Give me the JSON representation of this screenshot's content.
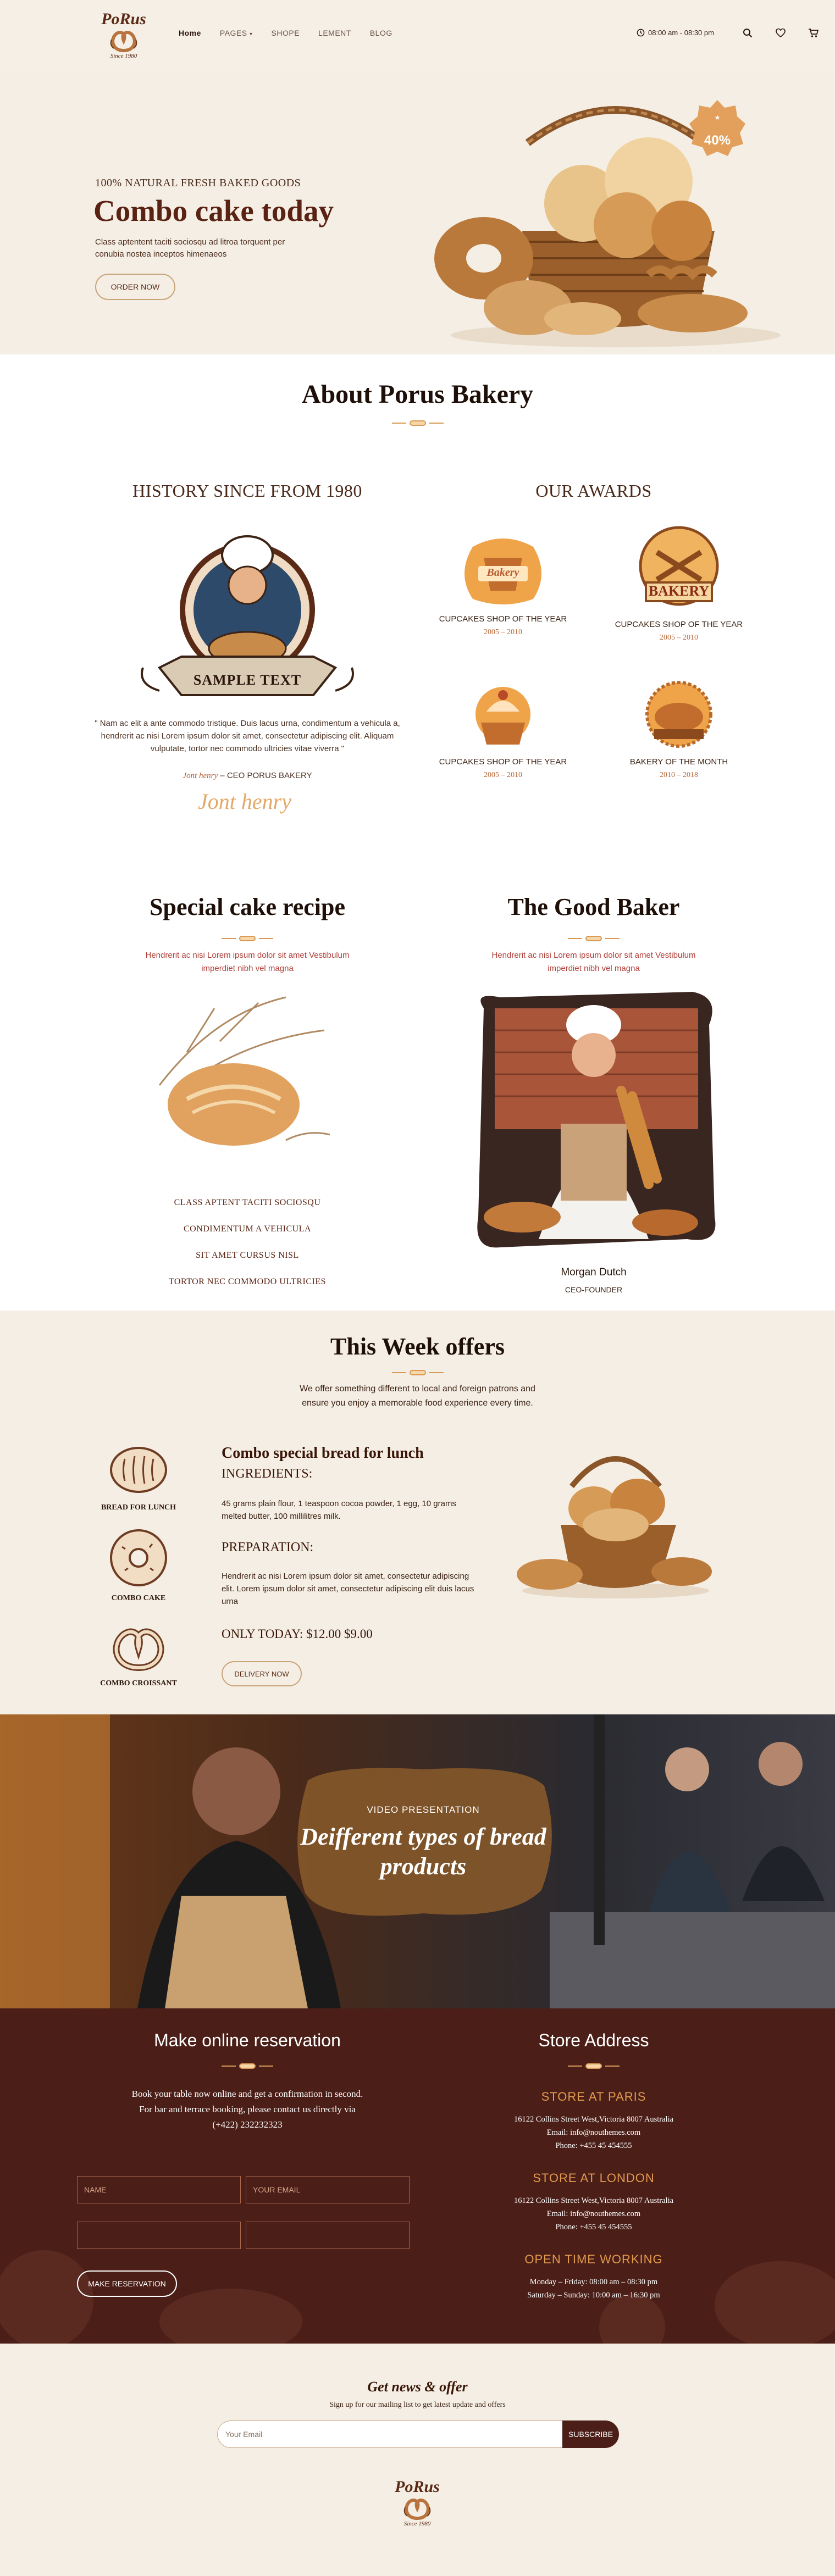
{
  "header": {
    "logo": {
      "brand": "PoRus",
      "since": "Since 1980"
    },
    "nav": [
      "Home",
      "PAGES",
      "SHOPE",
      "LEMENT",
      "BLOG"
    ],
    "hours": "08:00 am - 08:30 pm",
    "icons": [
      "search-icon",
      "heart-icon",
      "cart-icon"
    ]
  },
  "hero": {
    "eyebrow": "100% NATURAL FRESH BAKED GOODS",
    "title": "Combo cake today",
    "text": "Class aptentent taciti sociosqu ad litroa torquent per conubia nostea inceptos himenaeos",
    "button": "ORDER NOW",
    "badge": "40%"
  },
  "about": {
    "title": "About Porus Bakery",
    "history_title": "HISTORY SINCE FROM 1980",
    "emblem_text": "SAMPLE TEXT",
    "quote": "\" Nam ac elit a ante commodo tristique. Duis lacus urna, condimentum a vehicula a, hendrerit ac nisi Lorem ipsum dolor sit amet, consectetur adipiscing elit. Aliquam vulputate, tortor nec commodo ultricies vitae viverra \"",
    "author": "Jont henry",
    "author_role": " – CEO PORUS BAKERY",
    "signature": "Jont henry",
    "awards_title": "OUR AWARDS",
    "awards": [
      {
        "name": "CUPCAKES SHOP OF THE YEAR",
        "years": "2005 – 2010",
        "badge": "Bakery"
      },
      {
        "name": "CUPCAKES SHOP OF THE YEAR",
        "years": "2005 – 2010",
        "badge": "BAKERY"
      },
      {
        "name": "CUPCAKES SHOP OF THE YEAR",
        "years": "2005 – 2010",
        "badge": ""
      },
      {
        "name": "BAKERY OF THE MONTH",
        "years": "2010 – 2018",
        "badge": ""
      }
    ]
  },
  "recipe": {
    "title": "Special cake recipe",
    "text": "Hendrerit ac nisi Lorem ipsum dolor sit amet Vestibulum imperdiet nibh vel magna",
    "list": [
      "CLASS APTENT TACITI SOCIOSQU",
      "CONDIMENTUM A VEHICULA",
      "SIT AMET CURSUS NISL",
      "TORTOR NEC COMMODO ULTRICIES"
    ]
  },
  "baker": {
    "title": "The Good Baker",
    "text": "Hendrerit ac nisi Lorem ipsum dolor sit amet Vestibulum imperdiet nibh vel magna",
    "name": "Morgan Dutch",
    "role": "CEO-FOUNDER"
  },
  "offers": {
    "title": "This Week offers",
    "text": "We offer something different to local and foreign patrons and ensure you enjoy a memorable food experience every time.",
    "items": [
      "BREAD FOR LUNCH",
      "COMBO CAKE",
      "COMBO CROISSANT"
    ],
    "heading": "Combo special bread for lunch",
    "ingredients_label": "INGREDIENTS:",
    "ingredients": "45 grams plain flour, 1 teaspoon cocoa powder, 1 egg, 10 grams melted butter, 100 millilitres milk.",
    "preparation_label": "PREPARATION:",
    "preparation": "Hendrerit ac nisi Lorem ipsum dolor sit amet, consectetur adipiscing elit. Lorem ipsum dolor sit amet, consectetur adipiscing elit duis lacus urna",
    "price": "ONLY TODAY: $12.00 $9.00",
    "button": "DELIVERY NOW"
  },
  "video": {
    "eyebrow": "VIDEO PRESENTATION",
    "title": "Deifferent types of bread products"
  },
  "reservation": {
    "title": "Make online reservation",
    "text": "Book your table now online and get a confirmation in second. For bar and terrace booking, please contact us directly via (+422) 232232323",
    "name_placeholder": "NAME",
    "email_placeholder": "YOUR EMAIL",
    "button": "MAKE RESERVATION"
  },
  "stores": {
    "title": "Store Address",
    "locations": [
      {
        "name": "STORE AT PARIS",
        "address": "16122 Collins Street West,Victoria 8007 Australia",
        "email": "Email: info@nouthemes.com",
        "phone": "Phone: +455 45 454555"
      },
      {
        "name": "STORE AT LONDON",
        "address": "16122 Collins Street West,Victoria 8007 Australia",
        "email": "Email: info@nouthemes.com",
        "phone": "Phone: +455 45 454555"
      }
    ],
    "hours_title": "OPEN TIME WORKING",
    "hours": [
      "Monday – Friday: 08:00 am – 08:30 pm",
      "Saturday – Sunday: 10:00 am – 16:30 pm"
    ]
  },
  "newsletter": {
    "title": "Get news & offer",
    "text": "Sign up for our mailing list to get latest update and offers",
    "placeholder": "Your Email",
    "button": "SUBSCRIBE"
  },
  "colors": {
    "brown": "#4b1f18",
    "cream": "#f5eee4",
    "accent": "#e29a4e"
  }
}
